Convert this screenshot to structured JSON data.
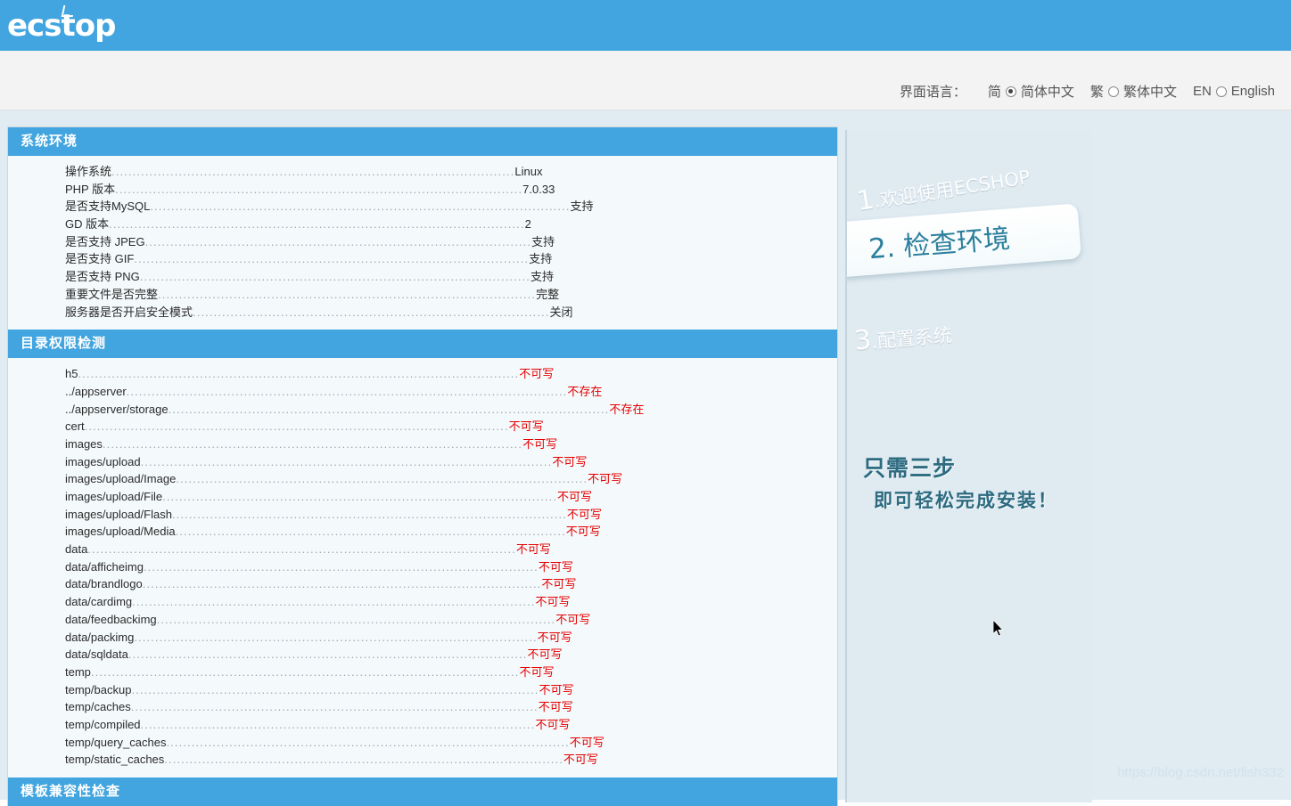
{
  "brand": {
    "logo_text": "ECSHOP"
  },
  "language_bar": {
    "label": "界面语言：",
    "options": [
      {
        "tag": "简",
        "name": "简体中文",
        "selected": true
      },
      {
        "tag": "繁",
        "name": "繁体中文",
        "selected": false
      },
      {
        "tag": "EN",
        "name": "English",
        "selected": false
      }
    ]
  },
  "sections": [
    {
      "title": "系统环境",
      "rows": [
        {
          "label": "操作系统",
          "value": "Linux",
          "status": "ok",
          "dots": 96
        },
        {
          "label": "PHP 版本",
          "value": "7.0.33",
          "status": "ok",
          "dots": 97
        },
        {
          "label": "是否支持MySQL",
          "value": "支持",
          "status": "ok",
          "dots": 100
        },
        {
          "label": "GD 版本",
          "value": "2",
          "status": "ok",
          "dots": 99
        },
        {
          "label": "是否支持 JPEG",
          "value": "支持",
          "status": "ok",
          "dots": 92
        },
        {
          "label": "是否支持 GIF",
          "value": "支持",
          "status": "ok",
          "dots": 94
        },
        {
          "label": "是否支持 PNG",
          "value": "支持",
          "status": "ok",
          "dots": 93
        },
        {
          "label": "重要文件是否完整",
          "value": "完整",
          "status": "ok",
          "dots": 90
        },
        {
          "label": "服务器是否开启安全模式",
          "value": "关闭",
          "status": "ok",
          "dots": 85
        }
      ]
    },
    {
      "title": "目录权限检测",
      "rows": [
        {
          "label": "h5",
          "value": "不可写",
          "status": "bad",
          "dots": 105
        },
        {
          "label": "../appserver",
          "value": "不存在",
          "status": "bad",
          "dots": 105
        },
        {
          "label": "../appserver/storage",
          "value": "不存在",
          "status": "bad",
          "dots": 105
        },
        {
          "label": "cert",
          "value": "不可写",
          "status": "bad",
          "dots": 101
        },
        {
          "label": "images",
          "value": "不可写",
          "status": "bad",
          "dots": 100
        },
        {
          "label": "images/upload",
          "value": "不可写",
          "status": "bad",
          "dots": 98
        },
        {
          "label": "images/upload/Image",
          "value": "不可写",
          "status": "bad",
          "dots": 98
        },
        {
          "label": "images/upload/File",
          "value": "不可写",
          "status": "bad",
          "dots": 94
        },
        {
          "label": "images/upload/Flash",
          "value": "不可写",
          "status": "bad",
          "dots": 94
        },
        {
          "label": "images/upload/Media",
          "value": "不可写",
          "status": "bad",
          "dots": 93
        },
        {
          "label": "data",
          "value": "不可写",
          "status": "bad",
          "dots": 102
        },
        {
          "label": "data/afficheimg",
          "value": "不可写",
          "status": "bad",
          "dots": 94
        },
        {
          "label": "data/brandlogo",
          "value": "不可写",
          "status": "bad",
          "dots": 95
        },
        {
          "label": "data/cardimg",
          "value": "不可写",
          "status": "bad",
          "dots": 96
        },
        {
          "label": "data/feedbackimg",
          "value": "不可写",
          "status": "bad",
          "dots": 95
        },
        {
          "label": "data/packimg",
          "value": "不可写",
          "status": "bad",
          "dots": 96
        },
        {
          "label": "data/sqldata",
          "value": "不可写",
          "status": "bad",
          "dots": 95
        },
        {
          "label": "temp",
          "value": "不可写",
          "status": "bad",
          "dots": 102
        },
        {
          "label": "temp/backup",
          "value": "不可写",
          "status": "bad",
          "dots": 97
        },
        {
          "label": "temp/caches",
          "value": "不可写",
          "status": "bad",
          "dots": 97
        },
        {
          "label": "temp/compiled",
          "value": "不可写",
          "status": "bad",
          "dots": 94
        },
        {
          "label": "temp/query_caches",
          "value": "不可写",
          "status": "bad",
          "dots": 96
        },
        {
          "label": "temp/static_caches",
          "value": "不可写",
          "status": "bad",
          "dots": 95
        }
      ]
    },
    {
      "title": "模板兼容性检查",
      "rows": []
    }
  ],
  "illustration": {
    "step1_num": "1",
    "step1_text": ".欢迎使用ECSHOP",
    "step2_num": "2",
    "step2_text": ". 检查环境",
    "step3_num": "3",
    "step3_text": ".配置系统",
    "slogan_line1": "只需三步",
    "slogan_line2": "即可轻松完成安装！"
  },
  "watermark": "https://blog.csdn.net/fish332",
  "colors": {
    "banner": "#42a5df",
    "section_header": "#42a5df",
    "error_text": "#e60000",
    "page_bg": "#e0ebf2",
    "panel_bg": "#f4f9fb",
    "illus_bg": "#dfeaf1",
    "step2_text": "#2b7f9c",
    "slogan": "#2d6b80"
  }
}
